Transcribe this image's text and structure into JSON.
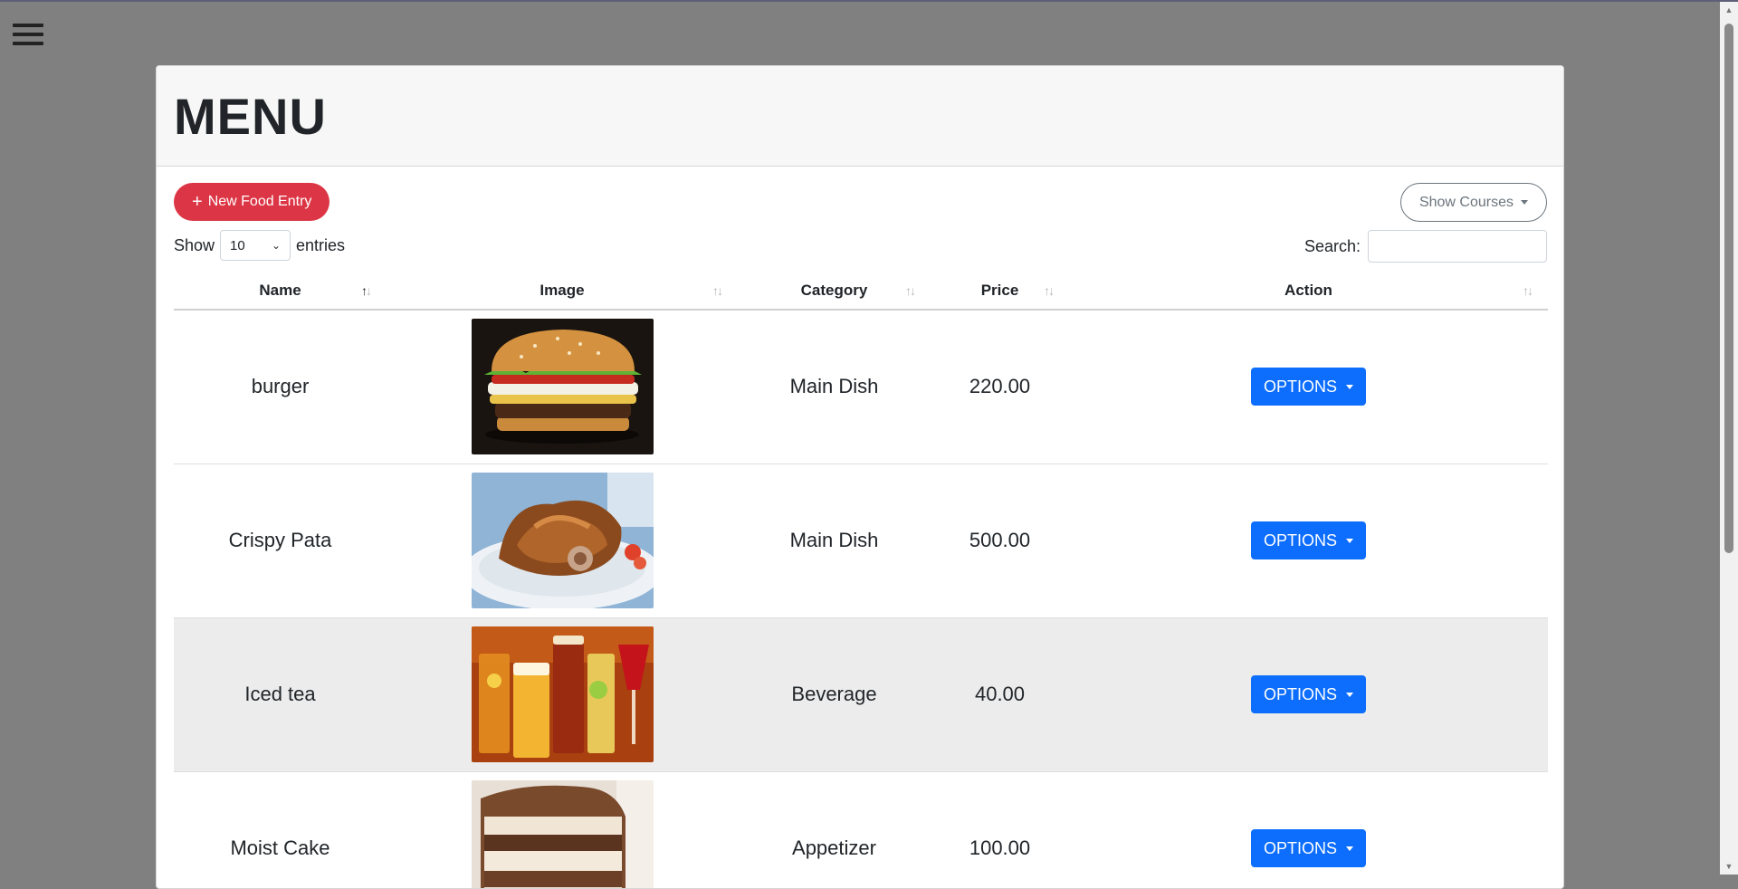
{
  "page": {
    "title": "MENU"
  },
  "toolbar": {
    "new_entry_label": "New Food Entry",
    "show_courses_label": "Show Courses"
  },
  "table_controls": {
    "show_label": "Show",
    "entries_value": "10",
    "entries_label": "entries",
    "search_label": "Search:",
    "search_value": ""
  },
  "table": {
    "columns": [
      "Name",
      "Image",
      "Category",
      "Price",
      "Action"
    ],
    "sorted_column": "Name",
    "rows": [
      {
        "name": "burger",
        "image": "burger photo",
        "category": "Main Dish",
        "price": "220.00",
        "action": "OPTIONS"
      },
      {
        "name": "Crispy Pata",
        "image": "crispy pata photo",
        "category": "Main Dish",
        "price": "500.00",
        "action": "OPTIONS"
      },
      {
        "name": "Iced tea",
        "image": "drinks photo",
        "category": "Beverage",
        "price": "40.00",
        "action": "OPTIONS"
      },
      {
        "name": "Moist Cake",
        "image": "cake photo",
        "category": "Appetizer",
        "price": "100.00",
        "action": "OPTIONS"
      }
    ]
  },
  "colors": {
    "backdrop": "#808080",
    "danger": "#dc3545",
    "primary": "#0d6efd",
    "secondary": "#6c757d",
    "striped_row": "#ececec"
  },
  "icons": [
    "hamburger-menu-icon",
    "plus-icon",
    "caret-down-icon",
    "chevron-down-icon",
    "sort-icon"
  ]
}
